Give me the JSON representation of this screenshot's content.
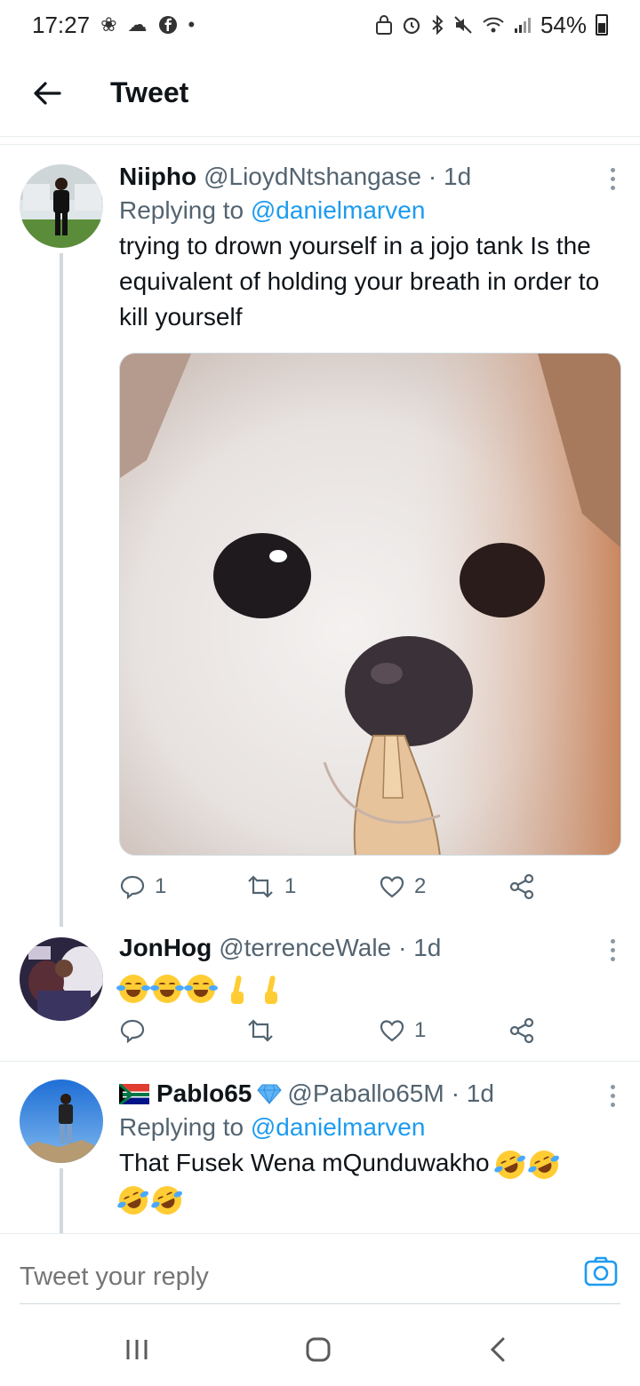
{
  "status_bar": {
    "time": "17:27",
    "battery": "54%"
  },
  "header": {
    "title": "Tweet"
  },
  "tweets": [
    {
      "name": "Niipho",
      "handle": "@LioydNtshangase",
      "time": "· 1d",
      "replying_prefix": "Replying to",
      "replying_to": "@danielmarven",
      "text": "trying to drown yourself in a jojo tank Is the equivalent of holding your breath in order to kill yourself",
      "replies": "1",
      "retweets": "1",
      "likes": "2"
    },
    {
      "name": "JonHog",
      "handle": "@terrenceWale",
      "time": "· 1d",
      "replies": "",
      "retweets": "",
      "likes": "1"
    },
    {
      "name": "Pablo65",
      "handle": "@Paballo65M",
      "time": "· 1d",
      "replying_prefix": "Replying to",
      "replying_to": "@danielmarven",
      "text": "That Fusek Wena  mQunduwakho"
    }
  ],
  "reply_bar": {
    "placeholder": "Tweet your reply"
  },
  "colors": {
    "accent": "#1d9bf0",
    "secondary_text": "#536471",
    "primary_text": "#0f1419",
    "divider": "#e6ecf0"
  }
}
